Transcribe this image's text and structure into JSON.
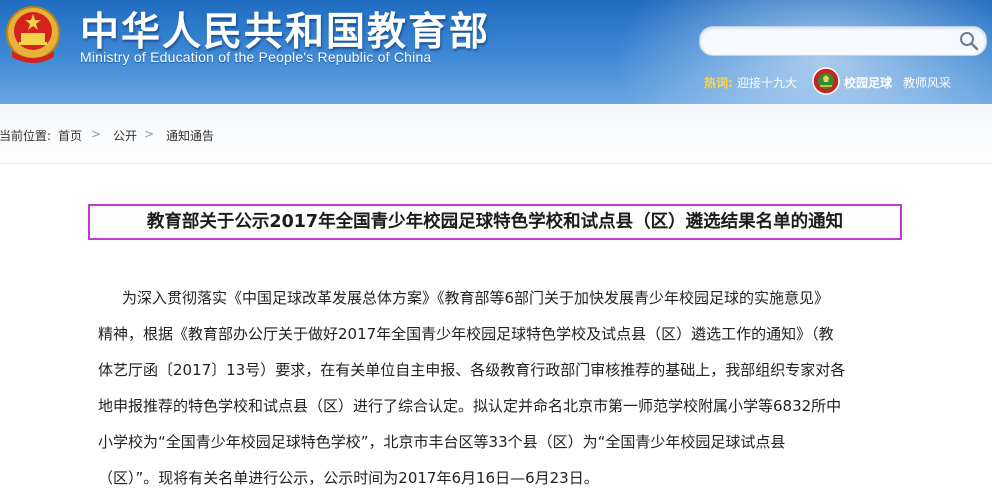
{
  "header": {
    "site_title": "中华人民共和国教育部",
    "site_subtitle": "Ministry of Education of the People's Republic of China",
    "search": {
      "value": "",
      "placeholder": ""
    },
    "hot": {
      "label": "热词:",
      "link_1": "迎接十九大",
      "link_2": "校园足球",
      "link_3": "教师风采"
    }
  },
  "breadcrumb": {
    "label": "当前位置:",
    "items": [
      "首页",
      "公开",
      "通知通告"
    ],
    "separator": ">"
  },
  "article": {
    "title": "教育部关于公示2017年全国青少年校园足球特色学校和试点县（区）遴选结果名单的通知",
    "body_lines": [
      "为深入贯彻落实《中国足球改革发展总体方案》《教育部等6部门关于加快发展青少年校园足球的实施意见》",
      "精神，根据《教育部办公厅关于做好2017年全国青少年校园足球特色学校及试点县（区）遴选工作的通知》（教",
      "体艺厅函〔2017〕13号）要求，在有关单位自主申报、各级教育行政部门审核推荐的基础上，我部组织专家对各",
      "地申报推荐的特色学校和试点县（区）进行了综合认定。拟认定并命名北京市第一师范学校附属小学等6832所中",
      "小学校为“全国青少年校园足球特色学校”，北京市丰台区等33个县（区）为“全国青少年校园足球试点县",
      "（区）”。现将有关名单进行公示，公示时间为2017年6月16日—6月23日。"
    ]
  },
  "colors": {
    "header_blue": "#1f6cc0",
    "hot_label": "#ffd24a",
    "title_highlight_border": "#c13bd1"
  },
  "icons": {
    "emblem": "national-emblem-icon",
    "search": "search-icon",
    "football": "football-icon"
  }
}
